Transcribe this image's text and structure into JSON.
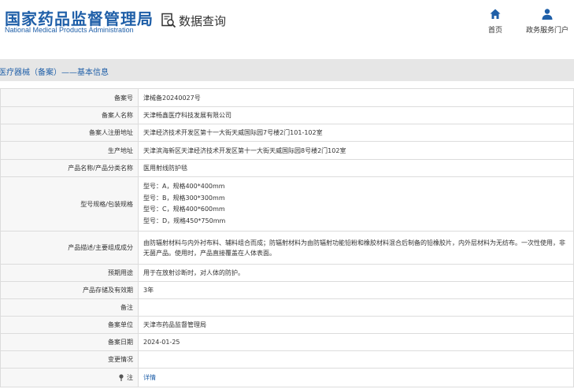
{
  "header": {
    "logo_cn": "国家药品监督管理局",
    "logo_en": "National Medical Products Administration",
    "query_label": "数据查询",
    "nav": [
      {
        "label": "首页",
        "icon": "home-icon"
      },
      {
        "label": "政务服务门户",
        "icon": "user-icon"
      }
    ]
  },
  "section": {
    "title": "医疗器械（备案）——基本信息"
  },
  "colors": {
    "brand": "#1f5fa8",
    "section_bg": "#e6e6e6",
    "label_bg": "#f7f7f7",
    "border": "#dcdcdc"
  },
  "rows": [
    {
      "label": "备案号",
      "value": "津械备20240027号"
    },
    {
      "label": "备案人名称",
      "value": "天津畅鑫医疗科技发展有限公司"
    },
    {
      "label": "备案人注册地址",
      "value": "天津经济技术开发区第十一大街天威国际园7号楼2门101-102室"
    },
    {
      "label": "生产地址",
      "value": "天津滨海新区天津经济技术开发区第十一大街天威国际园8号楼2门102室"
    },
    {
      "label": "产品名称/产品分类名称",
      "value": "医用射线防护毯"
    },
    {
      "label": "型号规格/包装规格",
      "lines": [
        "型号：A，规格400*400mm",
        "型号：B，规格300*300mm",
        "型号：C，规格400*600mm",
        "型号：D，规格450*750mm"
      ]
    },
    {
      "label": "产品描述/主要组成成分",
      "value": "由防辐射材料与内外衬布料、辅料组合而成；防辐射材料为由防辐射功能铅粉和橡胶材料混合后制备的铅橡胶片，内外层材料为无纺布。一次性使用，非无菌产品。使用时，产品直接覆盖在人体表面。"
    },
    {
      "label": "预期用途",
      "value": "用于在放射诊断时，对人体的防护。"
    },
    {
      "label": "产品存储及有效期",
      "value": "3年"
    },
    {
      "label": "备注",
      "value": ""
    },
    {
      "label": "备案单位",
      "value": "天津市药品监督管理局"
    },
    {
      "label": "备案日期",
      "value": "2024-01-25"
    },
    {
      "label": "变更情况",
      "value": ""
    },
    {
      "label": "注",
      "icon": "note-icon",
      "link": "详情"
    }
  ]
}
